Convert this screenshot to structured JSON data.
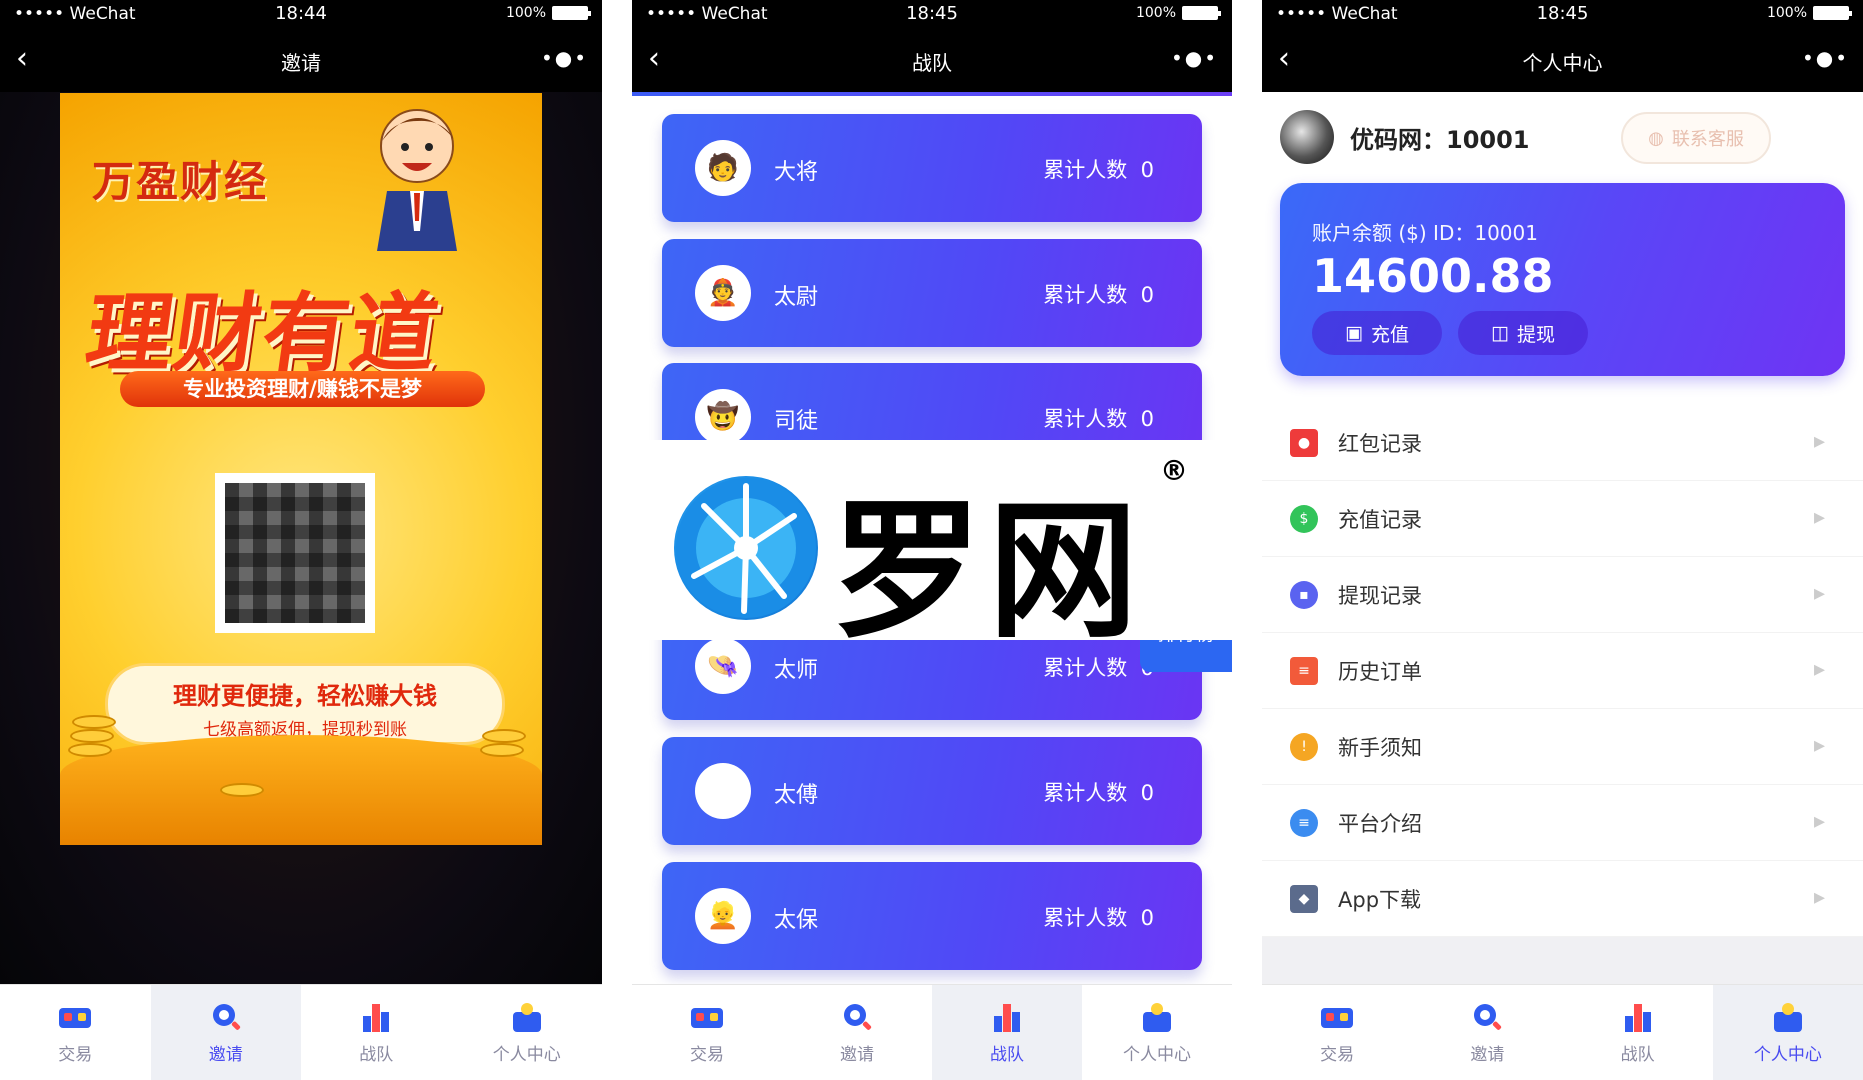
{
  "status_bar": {
    "carrier": "••••• WeChat",
    "battery": "100%"
  },
  "tabs": [
    {
      "label": "交易",
      "icon": "vr-glasses-icon"
    },
    {
      "label": "邀请",
      "icon": "search-icon"
    },
    {
      "label": "战队",
      "icon": "bar-chart-icon"
    },
    {
      "label": "个人中心",
      "icon": "person-bag-icon"
    }
  ],
  "screen1": {
    "time": "18:44",
    "title": "邀请",
    "poster": {
      "brand": "万盈财经",
      "headline": "理财有道",
      "subheadline": "专业投资理财/赚钱不是梦",
      "note_line1": "理财更便捷，轻松赚大钱",
      "note_line2": "七级高额返佣，提现秒到账"
    },
    "active_tab": 1
  },
  "screen2": {
    "time": "18:45",
    "title": "战队",
    "count_label": "累计人数",
    "teams": [
      {
        "name": "大将",
        "count": "0",
        "avatar": "general-avatar-icon"
      },
      {
        "name": "太尉",
        "count": "0",
        "avatar": "officer-avatar-icon"
      },
      {
        "name": "司徒",
        "count": "0",
        "avatar": "cowboy-avatar-icon"
      },
      {
        "name": "太师",
        "count": "0",
        "avatar": "tutor-avatar-icon"
      },
      {
        "name": "太傅",
        "count": "0",
        "avatar": "mentor-avatar-icon"
      },
      {
        "name": "太保",
        "count": "0",
        "avatar": "guardian-avatar-icon"
      }
    ],
    "rank_button": "排行榜",
    "active_tab": 2
  },
  "watermark": {
    "text": "罗网",
    "reg": "®"
  },
  "screen3": {
    "time": "18:45",
    "title": "个人中心",
    "user_name": "优码网：10001",
    "contact_button": "联系客服",
    "balance_label": "账户余额 ($) ID：10001",
    "balance_amount": "14600.88",
    "recharge_button": "充值",
    "withdraw_button": "提现",
    "menu": [
      {
        "label": "红包记录",
        "icon": "red-envelope-icon",
        "color": "#ee3b3b"
      },
      {
        "label": "充值记录",
        "icon": "recharge-icon",
        "color": "#32c45a"
      },
      {
        "label": "提现记录",
        "icon": "wallet-icon",
        "color": "#5a63f0"
      },
      {
        "label": "历史订单",
        "icon": "clipboard-icon",
        "color": "#f25a3a"
      },
      {
        "label": "新手须知",
        "icon": "info-icon",
        "color": "#f5a623"
      },
      {
        "label": "平台介绍",
        "icon": "list-icon",
        "color": "#3b8cf0"
      },
      {
        "label": "App下载",
        "icon": "cube-icon",
        "color": "#5b6b8c"
      }
    ],
    "active_tab": 3
  },
  "colors": {
    "accent": "#4a4cf0",
    "card_start": "#3e66f6",
    "card_end": "#6a35f3"
  }
}
